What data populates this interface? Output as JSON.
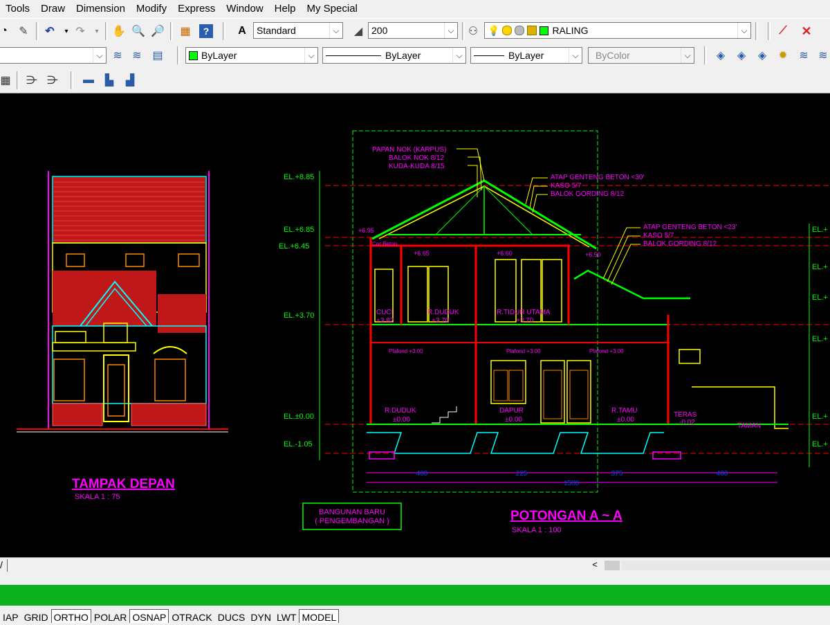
{
  "menu": [
    "Tools",
    "Draw",
    "Dimension",
    "Modify",
    "Express",
    "Window",
    "Help",
    "My Special"
  ],
  "toolbar1": {
    "text_style": "Standard",
    "dim_style": "200",
    "layer": "RALING"
  },
  "toolbar2": {
    "color": "ByLayer",
    "linetype": "ByLayer",
    "lineweight": "ByLayer",
    "plotstyle": "ByColor"
  },
  "colors": {
    "canvas": "#000000",
    "magenta": "#ff00ff",
    "yellow": "#ffff00",
    "green": "#00ff00",
    "red": "#ff0000",
    "cyan": "#00ffff",
    "status_green": "#0cb21d"
  },
  "drawing": {
    "front": {
      "title": "TAMPAK DEPAN",
      "scale": "SKALA 1 : 75"
    },
    "section": {
      "title": "POTONGAN A ~ A",
      "scale": "SKALA 1 : 100",
      "roof_notes_top": [
        "PAPAN NOK (KARPUS)",
        "BALOK NOK 8/12",
        "KUDA-KUDA 8/15"
      ],
      "roof_notes_right": [
        "ATAP GENTENG BETON <30'",
        "KASO 5/7",
        "BALOK GORDING 8/12"
      ],
      "roof_notes_right2": [
        "ATAP GENTENG BETON <23'",
        "KASO 5/7",
        "BALOK GORDING 8/12"
      ],
      "elevations_left": [
        "EL.+8.85",
        "EL.+6.85",
        "EL.+6.45",
        "EL.+3.70",
        "EL.±0.00",
        "EL.-1.05"
      ],
      "elevations_right": [
        "EL.+",
        "EL.+",
        "EL.+",
        "EL.+",
        "EL.+",
        "EL.+"
      ],
      "level_marks": [
        "+6.95",
        "+6.65",
        "+6.60",
        "+6.50"
      ],
      "rooms_upper": [
        {
          "name": "CUCI",
          "level": "+3.82"
        },
        {
          "name": "R.DUDUK",
          "level": "+3.70"
        },
        {
          "name": "R.TIDUR UTAMA",
          "level": "+3.70"
        }
      ],
      "rooms_lower": [
        {
          "name": "R.DUDUK",
          "level": "±0.00"
        },
        {
          "name": "DAPUR",
          "level": "±0.00"
        },
        {
          "name": "R.TAMU",
          "level": "±0.00"
        },
        {
          "name": "TERAS",
          "level": "-0.02"
        }
      ],
      "plafond": [
        "Plafond +3.00",
        "Plafond +3.00",
        "Plafond +3.00"
      ],
      "cor_beton": "Cor Beton",
      "taman": "TAMAN",
      "dims": [
        "400",
        "225",
        "375",
        "400"
      ],
      "dim_total": "1500",
      "new_building": [
        "BANGUNAN BARU",
        "( PENGEMBANGAN )"
      ]
    }
  },
  "statusbar": [
    {
      "label": "IAP",
      "on": false
    },
    {
      "label": "GRID",
      "on": false
    },
    {
      "label": "ORTHO",
      "on": true
    },
    {
      "label": "POLAR",
      "on": false
    },
    {
      "label": "OSNAP",
      "on": true
    },
    {
      "label": "OTRACK",
      "on": false
    },
    {
      "label": "DUCS",
      "on": false
    },
    {
      "label": "DYN",
      "on": false
    },
    {
      "label": "LWT",
      "on": false
    },
    {
      "label": "MODEL",
      "on": true
    }
  ]
}
